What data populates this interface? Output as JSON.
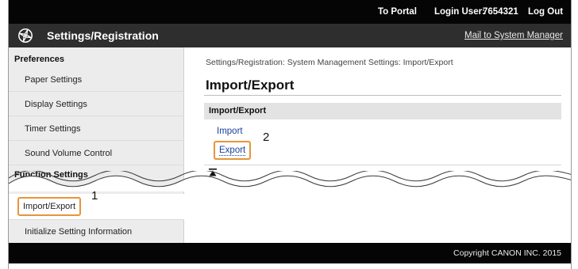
{
  "topbar": {
    "portal_label": "To Portal",
    "login_label": "Login User:",
    "login_user": "7654321",
    "logout_label": "Log Out"
  },
  "titlebar": {
    "app_icon": "settings-gear-icon",
    "title": "Settings/Registration",
    "mail_label": "Mail to System Manager"
  },
  "sidebar": {
    "preferences_heading": "Preferences",
    "items": [
      {
        "label": "Paper Settings"
      },
      {
        "label": "Display Settings"
      },
      {
        "label": "Timer Settings"
      },
      {
        "label": "Sound Volume Control"
      }
    ],
    "function_heading": "Function Settings",
    "function_items": [
      {
        "label": "Import/Export",
        "active": true
      },
      {
        "label": "Initialize Setting Information"
      }
    ]
  },
  "main": {
    "breadcrumb": "Settings/Registration: System Management Settings: Import/Export",
    "page_title": "Import/Export",
    "section_title": "Import/Export",
    "links": [
      "Import",
      "Export"
    ],
    "top_icon": "back-to-top-icon"
  },
  "callouts": {
    "one": "1",
    "two": "2"
  },
  "colors": {
    "highlight": "#e69538",
    "link": "#1a3f9e",
    "bar": "#050505"
  },
  "footer": {
    "copyright": "Copyright CANON INC. 2015"
  }
}
